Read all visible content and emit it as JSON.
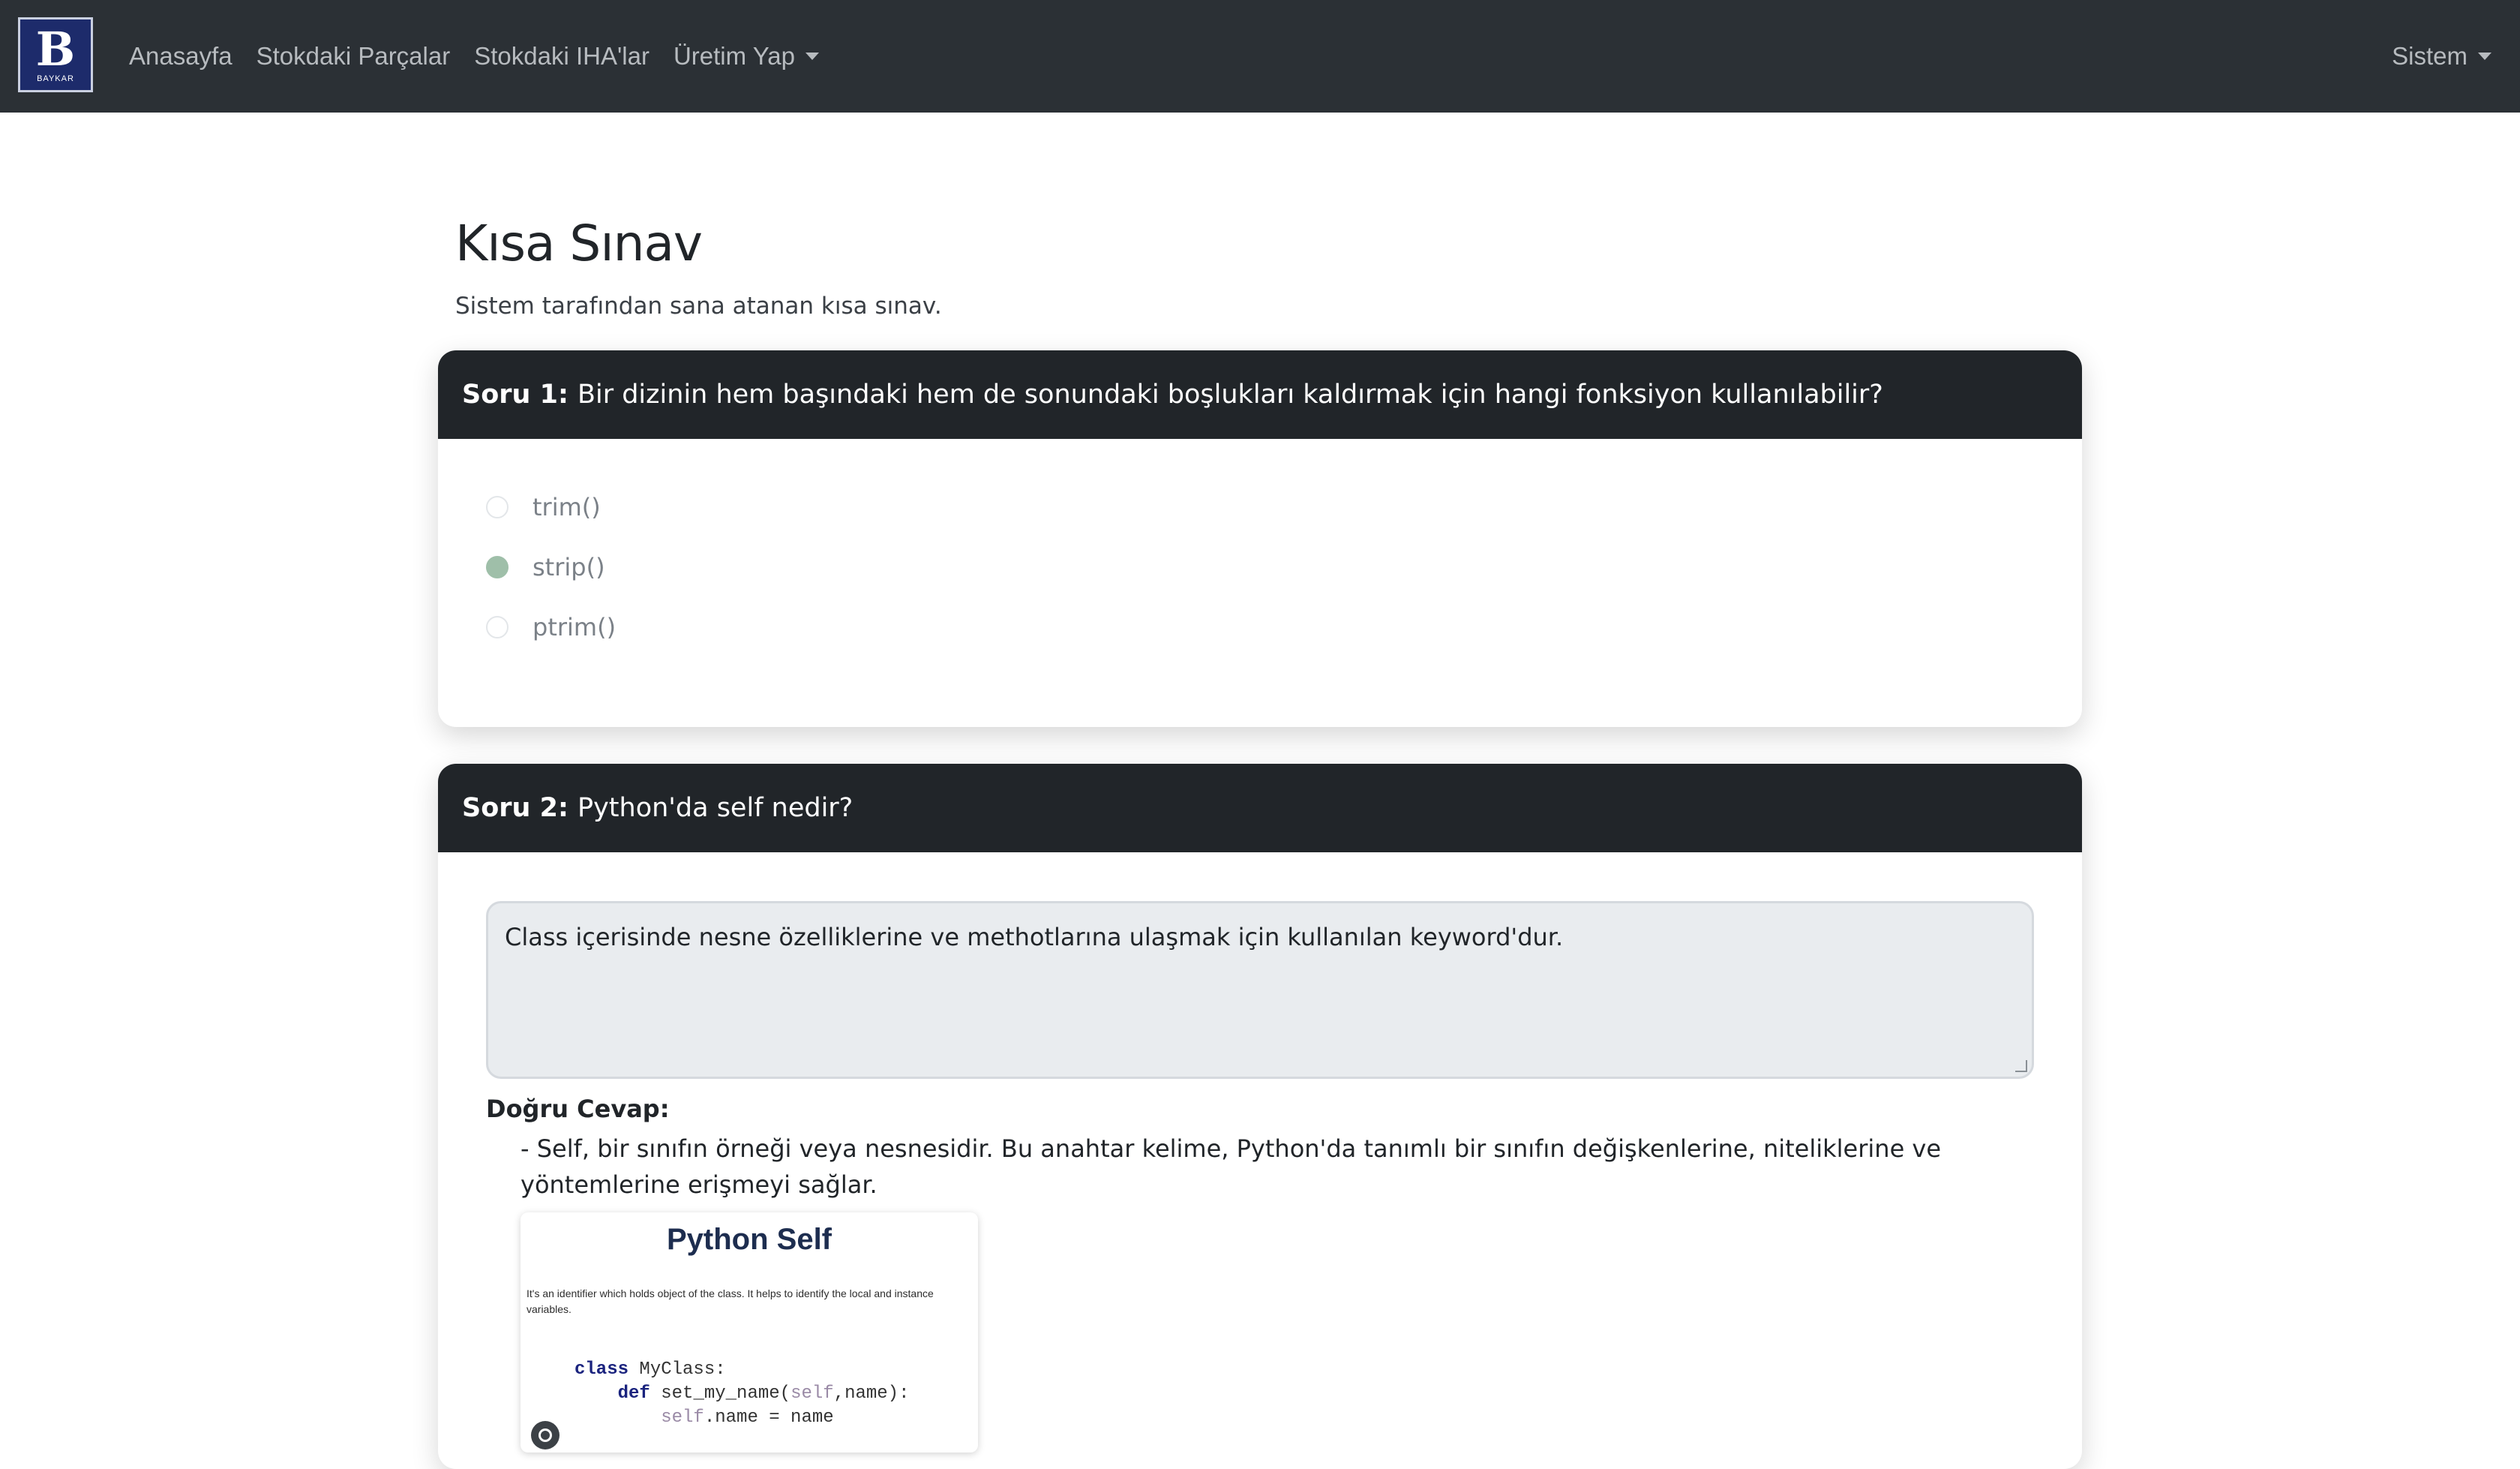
{
  "navbar": {
    "brand": {
      "mark": "B",
      "word": "BAYKAR"
    },
    "links": [
      "Anasayfa",
      "Stokdaki Parçalar",
      "Stokdaki IHA'lar",
      "Üretim Yap"
    ],
    "right_menu": "Sistem"
  },
  "page": {
    "title": "Kısa Sınav",
    "subtitle": "Sistem tarafından sana atanan kısa sınav."
  },
  "questions": [
    {
      "number": "Soru 1:",
      "text": "Bir dizinin hem başındaki hem de sonundaki boşlukları kaldırmak için hangi fonksiyon kullanılabilir?",
      "options": [
        "trim()",
        "strip()",
        "ptrim()"
      ],
      "selected": "strip()"
    },
    {
      "number": "Soru 2:",
      "text": "Python'da self nedir?",
      "answer": "Class içerisinde nesne özelliklerine ve methotlarına ulaşmak için kullanılan keyword'dur.",
      "correct_title": "Doğru Cevap:",
      "correct_text": "- Self, bir sınıfın örneği veya nesnesidir. Bu anahtar kelime, Python'da tanımlı bir sınıfın değişkenlerine, niteliklerine ve yöntemlerine erişmeyi sağlar.",
      "image": {
        "title": "Python Self",
        "description": "It's an identifier which holds object of the class. It helps to identify the local and instance variables.",
        "code": {
          "line1_kw": "class",
          "line1_rest": " MyClass:",
          "line2_kw": "def",
          "line2_mid": " set_my_name(",
          "line2_self": "self",
          "line2_end": ",name):",
          "line3_self": "self",
          "line3_rest": ".name = name"
        }
      }
    }
  ],
  "colors": {
    "navbar": "#2b3035",
    "card_header": "#212529",
    "selected_radio": "#9fbfa9",
    "answer_bg": "#e9ecef"
  }
}
